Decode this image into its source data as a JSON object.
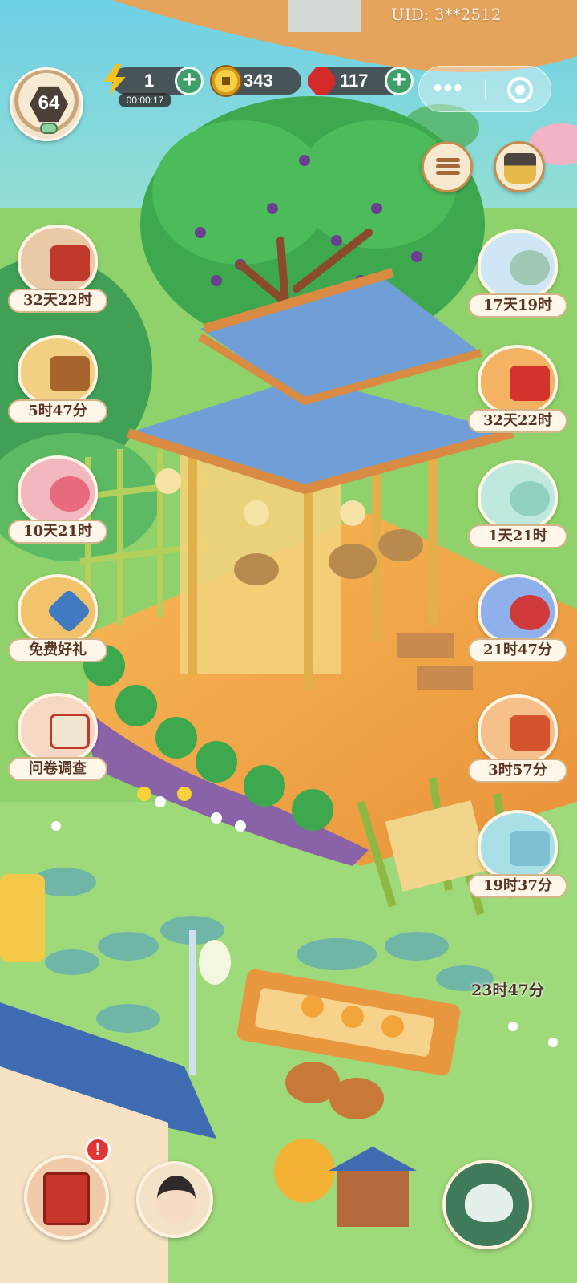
{
  "uid_text": "UID: 3**2512",
  "level": {
    "value": "64"
  },
  "energy": {
    "value": "1",
    "timer": "00:00:17"
  },
  "coins": {
    "value": "343"
  },
  "rubies": {
    "value": "117"
  },
  "left_events": [
    {
      "name": "event-newyear-calligraphy",
      "label": "32天22时",
      "color": "#e9c9a6"
    },
    {
      "name": "event-coin-chest",
      "label": "5时47分",
      "color": "#f3cf83"
    },
    {
      "name": "event-peony-fan",
      "label": "10天21时",
      "color": "#f3b7bf"
    },
    {
      "name": "event-free-gift",
      "label": "免费好礼",
      "color": "#f2c36a"
    },
    {
      "name": "event-survey",
      "label": "问卷调查",
      "color": "#f6d9c4"
    }
  ],
  "right_events": [
    {
      "name": "event-cat-cloud",
      "label": "17天19时",
      "color": "#cfe6f4"
    },
    {
      "name": "event-red-envelope",
      "label": "32天22时",
      "color": "#f4b363"
    },
    {
      "name": "event-cat-coins",
      "label": "1天21时",
      "color": "#bfe8df"
    },
    {
      "name": "event-red-fan",
      "label": "21时47分",
      "color": "#8fb0ea"
    },
    {
      "name": "event-banquet",
      "label": "3时57分",
      "color": "#f5c08a"
    },
    {
      "name": "event-cat-gift",
      "label": "19时37分",
      "color": "#a9dfe6"
    }
  ],
  "floating_timer": "23时47分",
  "notification_badge": "!",
  "icons": {
    "energy": "lightning-bolt-icon",
    "coin": "coin-icon",
    "ruby": "ruby-icon",
    "more": "more-dots-icon",
    "target": "target-icon",
    "list": "list-icon",
    "shop": "shop-icon"
  },
  "colors": {
    "grass": "#8fd16a",
    "wood_deck": "#f0a64a",
    "roof": "#6f9fd6",
    "plus_green": "#3f9f6b",
    "label_text": "#5a3523"
  }
}
